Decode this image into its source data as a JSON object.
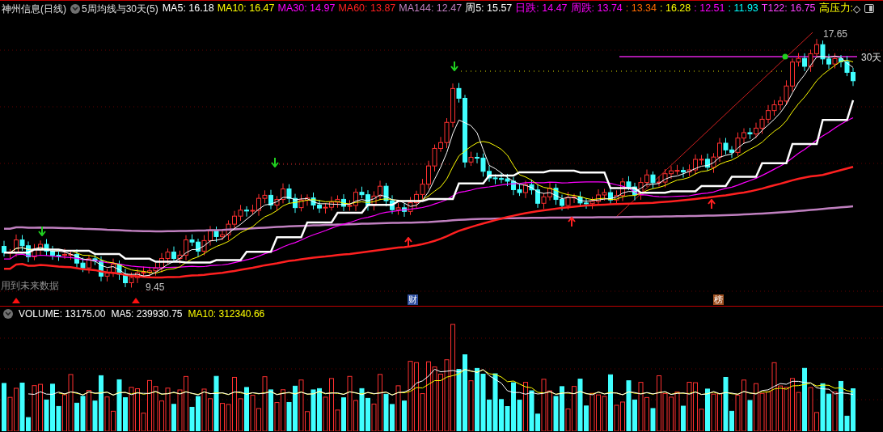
{
  "header": {
    "stock": "神州信息(日线)",
    "indicator": "5周均线与30天(5)",
    "values": [
      {
        "text": "MA5: 16.18",
        "color": "#ffffff"
      },
      {
        "text": "MA10: 16.47",
        "color": "#ffff00"
      },
      {
        "text": "MA30: 14.97",
        "color": "#ff00ff"
      },
      {
        "text": "MA60: 13.87",
        "color": "#ff2020"
      },
      {
        "text": "MA144: 12.47",
        "color": "#c080c0"
      },
      {
        "text": "周5: 15.57",
        "color": "#ffffff"
      },
      {
        "text": "日跌: 14.47",
        "color": "#ff00ff"
      },
      {
        "text": "周跌: 13.74",
        "color": "#ff00ff"
      },
      {
        "text": ": 13.34",
        "color": "#ff6a00"
      },
      {
        "text": ": 16.28",
        "color": "#ffff00"
      },
      {
        "text": ": 12.51",
        "color": "#ff00ff"
      },
      {
        "text": ": 11.93",
        "color": "#00ffff"
      },
      {
        "text": "T122: 16.75",
        "color": "#ff40ff"
      },
      {
        "text": "高压力:",
        "color": "#ffff00"
      }
    ],
    "glyph": "◇"
  },
  "chart_labels": {
    "high": "17.65",
    "low": "9.45",
    "line_label": "30天",
    "note": "用到未来数据"
  },
  "event_tags": [
    {
      "text": "财",
      "color": "#3050a0"
    },
    {
      "text": "榜",
      "color": "#a05020"
    }
  ],
  "volume_header": {
    "values": [
      {
        "text": "VOLUME: 13175.00",
        "color": "#ffffff"
      },
      {
        "text": "MA5: 239930.75",
        "color": "#ffffff"
      },
      {
        "text": "MA10: 312340.66",
        "color": "#ffff00"
      }
    ]
  }
}
